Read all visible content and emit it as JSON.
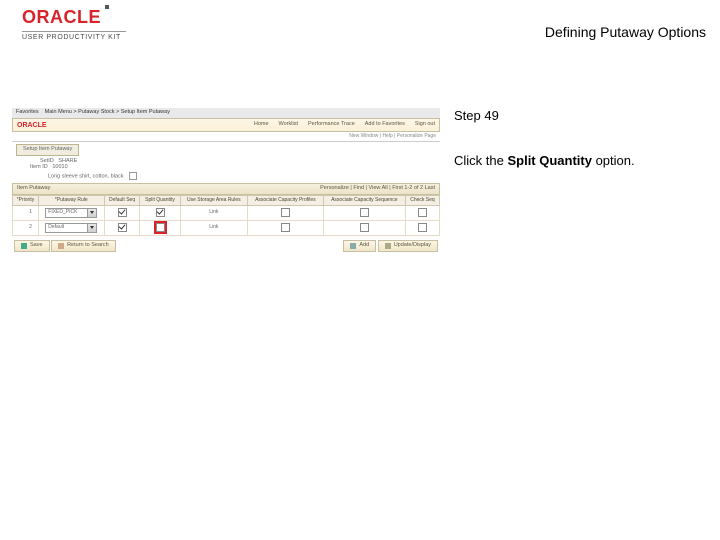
{
  "header": {
    "brand": "ORACLE",
    "subtitle": "USER PRODUCTIVITY KIT",
    "page_title": "Defining Putaway Options"
  },
  "instruction": {
    "step_label": "Step 49",
    "body_prefix": "Click the ",
    "body_bold": "Split Quantity",
    "body_suffix": " option."
  },
  "thumb": {
    "tabstrip": {
      "item1": "Favorites",
      "item2": "Main Menu > Putaway Stock > Setup Item Putaway"
    },
    "topbar": {
      "brand": "ORACLE",
      "links": [
        "Home",
        "Worklist",
        "Performance Trace",
        "Add to Favorites",
        "Sign out"
      ]
    },
    "subbar": "New Window | Help | Personalize Page",
    "active_tab": "Setup Item Putaway",
    "fields": {
      "setid_label": "SetID",
      "setid_value": "SHARE",
      "item_label": "Item ID",
      "item_value": "10010",
      "desc_value": "Long sleeve shirt, cotton, black"
    },
    "section": {
      "label": "Item Putaway",
      "nav": "Personalize | Find | View All  |  First  1-2 of 2  Last"
    },
    "columns": [
      "*Priority",
      "*Putaway Rule",
      "Default Seq",
      "Split Quantity",
      "Use Storage Area Rules",
      "Associate Capacity Profiles",
      "Associate Capacity Sequence",
      "Check Seq"
    ],
    "rows": [
      {
        "priority": "1",
        "zone_value": "FIXED_PICK",
        "default_seq_checked": true,
        "split_qty_checked": true,
        "split_qty_highlight": false,
        "link1": "Link",
        "chk2": false,
        "chk3": false,
        "chk4": false
      },
      {
        "priority": "2",
        "zone_value": "Default",
        "default_seq_checked": true,
        "split_qty_checked": false,
        "split_qty_highlight": true,
        "link1": "Link",
        "chk2": false,
        "chk3": false,
        "chk4": false
      }
    ],
    "footer": {
      "save": "Save",
      "find": "Return to Search",
      "add": "Add",
      "notif": "Update/Display"
    }
  }
}
